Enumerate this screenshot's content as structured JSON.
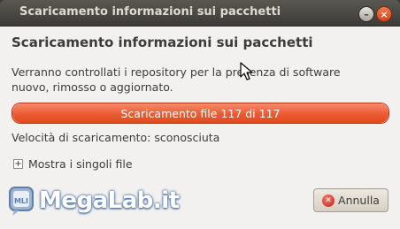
{
  "window": {
    "title": "Scaricamento informazioni sui pacchetti",
    "controls": {
      "minimize_icon": "minimize-icon",
      "close_icon": "close-icon"
    }
  },
  "dialog": {
    "heading": "Scaricamento informazioni sui pacchetti",
    "description": "Verranno controllati i repository per la presenza di software nuovo, rimosso o aggiornato.",
    "progress": {
      "label": "Scaricamento file 117 di 117",
      "fraction": 1.0
    },
    "speed": "Velocità di scaricamento: sconosciuta",
    "expander": {
      "label": "Mostra i singoli file",
      "icon": "plus-icon",
      "expanded": false
    },
    "cancel_button": {
      "label": "Annulla",
      "icon": "cancel-icon"
    }
  },
  "watermark": {
    "text": "MegaLab.it",
    "logo_text": "MLI"
  },
  "colors": {
    "accent": "#ec5b34",
    "titlebar": "#3c3b37",
    "background": "#f2f1f0",
    "text": "#3c3c3c"
  }
}
